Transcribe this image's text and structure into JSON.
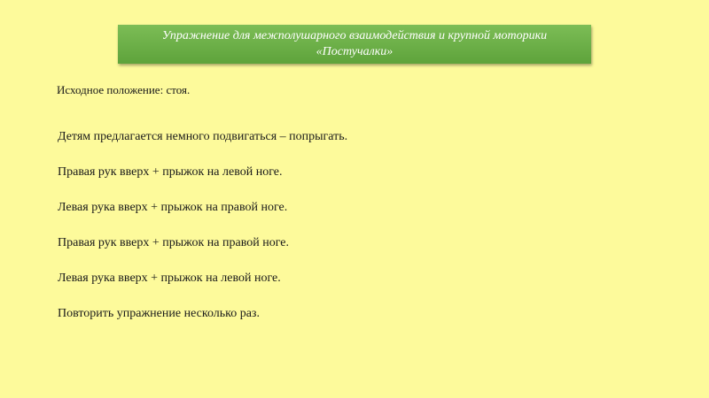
{
  "title": {
    "line1": "Упражнение для межполушарного взаимодействия и крупной моторики",
    "line2": "«Постучалки»"
  },
  "start_position": "Исходное положение: стоя.",
  "instructions": [
    "Детям предлагается немного подвигаться – попрыгать.",
    "Правая рук вверх + прыжок на левой ноге.",
    "Левая рука вверх + прыжок на правой ноге.",
    "Правая рук вверх + прыжок на правой ноге.",
    "Левая рука вверх + прыжок на левой ноге.",
    "Повторить упражнение несколько раз."
  ],
  "colors": {
    "background": "#fdfa9b",
    "title_box": "#6cb048",
    "title_text": "#ffffff"
  }
}
